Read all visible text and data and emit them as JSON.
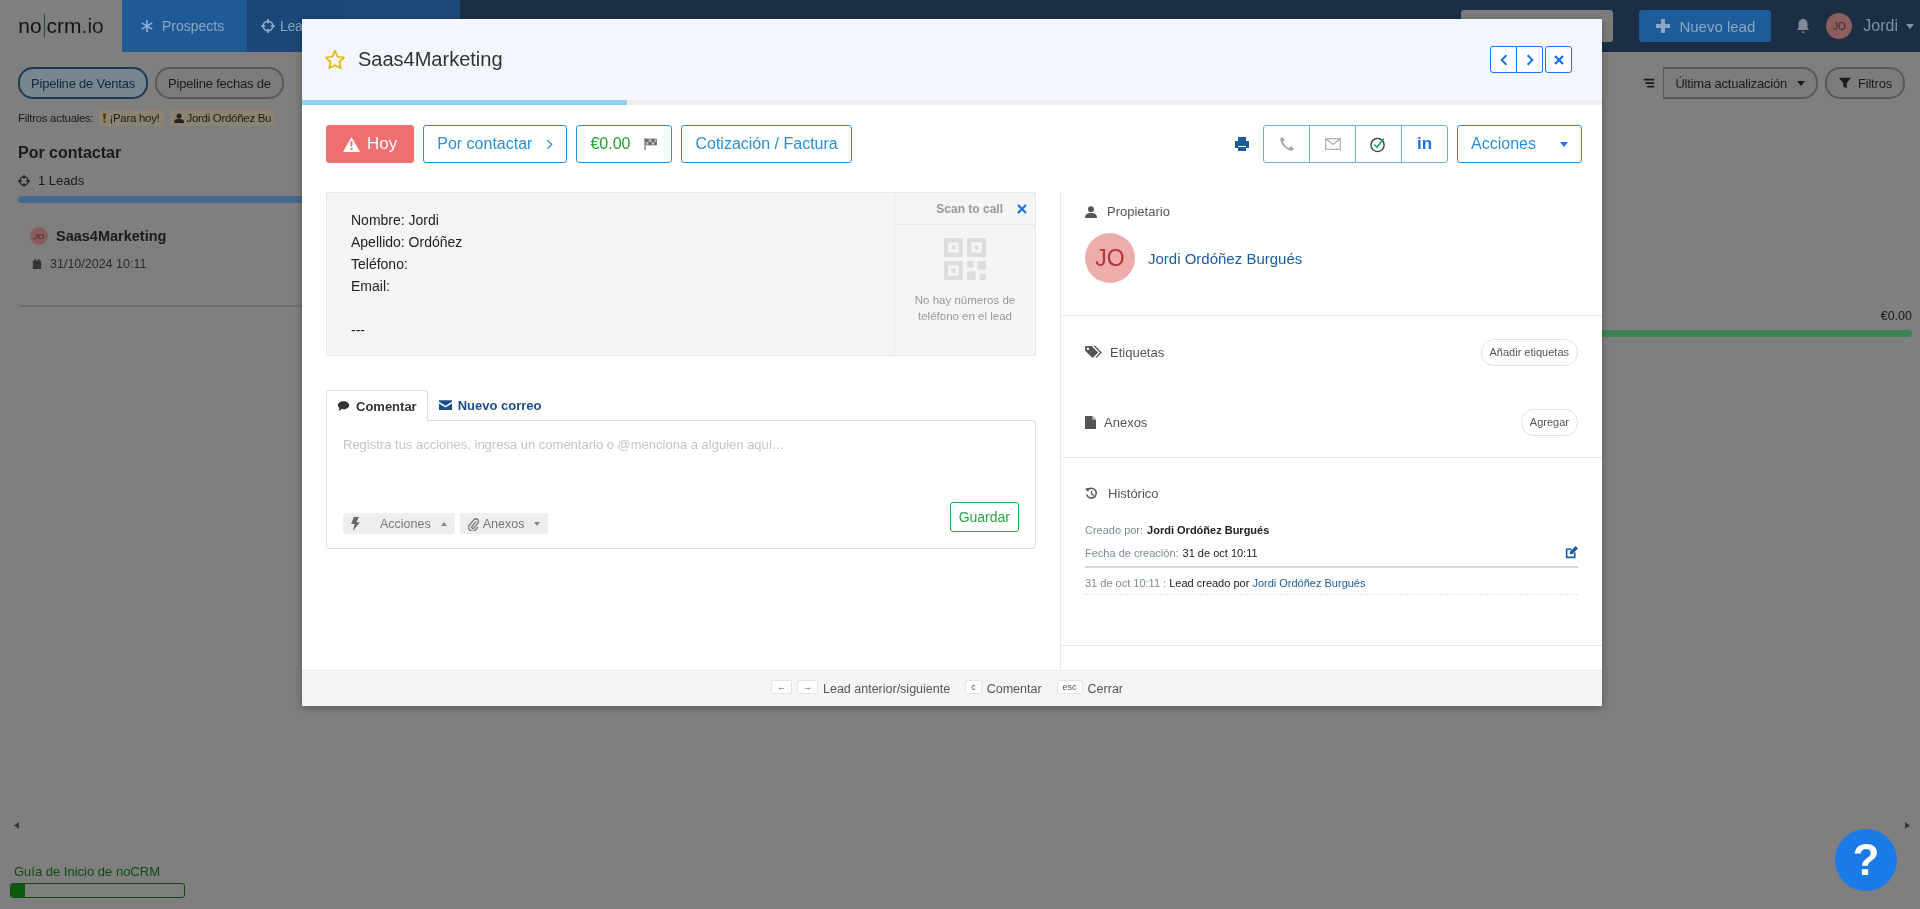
{
  "navbar": {
    "logo_left": "no",
    "logo_right": "crm",
    "logo_suffix": ".io",
    "tabs": [
      {
        "label": "Prospects",
        "selected": false
      },
      {
        "label": "Lea",
        "selected": true
      }
    ],
    "new_button": "Nuevo lead",
    "user": {
      "initials": "JO",
      "name": "Jordi"
    }
  },
  "pipelines": [
    {
      "label": "Pipeline de Ventas",
      "selected": true
    },
    {
      "label": "Pipeline fechas de",
      "selected": false
    }
  ],
  "sort": {
    "label": "Última actualización"
  },
  "filters_button": "Filtros",
  "filters": {
    "label": "Filtros actuales:",
    "chips": [
      {
        "kind": "alert",
        "label": "¡Para hoy!"
      },
      {
        "kind": "user",
        "label": "Jordi Ordóñez Bu"
      }
    ]
  },
  "column": {
    "title": "Por contactar",
    "count": "1 Leads",
    "cards": [
      {
        "initials": "JO",
        "name": "Saas4Marketing",
        "date": "31/10/2024 10:11"
      }
    ]
  },
  "column_total": "€0.00",
  "guide": {
    "label": "Guía de Inicio de noCRM",
    "level": 0.08
  },
  "help_button": "?",
  "modal": {
    "starred": false,
    "title": "Saas4Marketing",
    "level": 0.25,
    "toolbar": {
      "due": "Hoy",
      "step": "Por contactar",
      "amount": "€0.00",
      "quote": "Cotización / Factura",
      "contact_buttons": [
        {
          "kind": "phone",
          "disabled": true
        },
        {
          "kind": "mail",
          "disabled": true
        },
        {
          "kind": "task",
          "disabled": false
        },
        {
          "kind": "linkedin",
          "label": "in",
          "disabled": false
        }
      ],
      "actions": "Acciones"
    },
    "fields": [
      "Nombre: Jordi",
      "Apellido: Ordóñez",
      "Teléfono:",
      "Email:"
    ],
    "separator": "---",
    "scan": {
      "title": "Scan to call",
      "message": "No hay números de teléfono en el lead"
    },
    "comment_tabs": [
      {
        "kind": "comment",
        "label": "Comentar",
        "selected": true
      },
      {
        "kind": "mail",
        "label": "Nuevo correo",
        "selected": false
      }
    ],
    "comment": {
      "placeholder": "Registra tus acciones, ingresa un comentario o @menciona a alguien aquí...",
      "actions": "Acciones",
      "attachments": "Anexos",
      "save": "Guardar"
    },
    "owner": {
      "title": "Propietario",
      "initials": "JO",
      "name": "Jordi Ordóñez Burgués"
    },
    "tags": {
      "title": "Etiquetas",
      "button": "Añadir etiquetas"
    },
    "attachments": {
      "title": "Anexos",
      "button": "Agregar"
    },
    "history": {
      "title": "Histórico",
      "created_by_label": "Creado por:",
      "created_by": "Jordi Ordóñez Burgués",
      "created_at_label": "Fecha de creación:",
      "created_at": "31 de oct 10:11",
      "events": [
        {
          "time": "31 de oct 10:11 :",
          "text": "Lead creado por",
          "user": "Jordi Ordóñez Burgués"
        }
      ]
    },
    "shortcuts": [
      {
        "keys": [
          "←",
          "→"
        ],
        "label": "Lead anterior/siguiente"
      },
      {
        "keys": [
          "c"
        ],
        "label": "Comentar"
      },
      {
        "keys": [
          "esc"
        ],
        "label": "Cerrar"
      }
    ]
  }
}
